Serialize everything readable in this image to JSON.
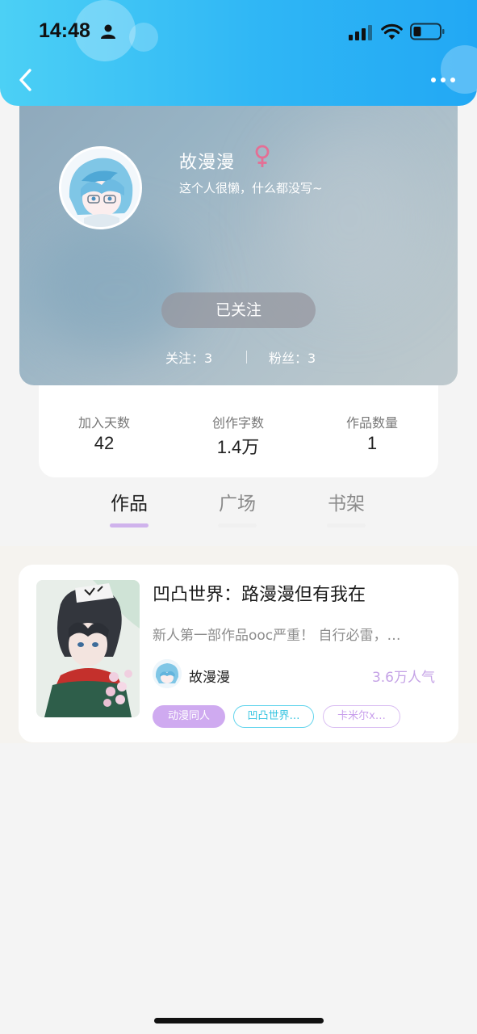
{
  "status_bar": {
    "time": "14:48",
    "icons": [
      "person-icon",
      "signal-icon",
      "wifi-icon",
      "battery-icon"
    ]
  },
  "nav": {
    "back_icon": "chevron-left-icon",
    "more_icon": "more-dots-icon"
  },
  "profile": {
    "name": "故漫漫",
    "gender_icon": "female-symbol-icon",
    "bio": "这个人很懒，什么都没写~",
    "follow_button_label": "已关注",
    "following_label": "关注：3",
    "fans_label": "粉丝：3"
  },
  "stats": [
    {
      "label": "加入天数",
      "value": "42"
    },
    {
      "label": "创作字数",
      "value": "1.4万"
    },
    {
      "label": "作品数量",
      "value": "1"
    }
  ],
  "tabs": [
    {
      "label": "作品",
      "active": true
    },
    {
      "label": "广场",
      "active": false
    },
    {
      "label": "书架",
      "active": false
    }
  ],
  "works": [
    {
      "title": "凹凸世界：路漫漫但有我在",
      "description": "新人第一部作品ooc严重！ 自行必雷，…",
      "author": "故漫漫",
      "popularity": "3.6万人气",
      "tags": [
        "动漫同人",
        "凹凸世界…",
        "卡米尔x…"
      ]
    }
  ],
  "colors": {
    "header_gradient_start": "#4cd0f5",
    "header_gradient_end": "#22a8f4",
    "accent_purple": "#cfb2ec",
    "popularity_color": "#c5a3e6",
    "gender_color": "#e46f95",
    "tag_cyan": "#35c4e0"
  }
}
